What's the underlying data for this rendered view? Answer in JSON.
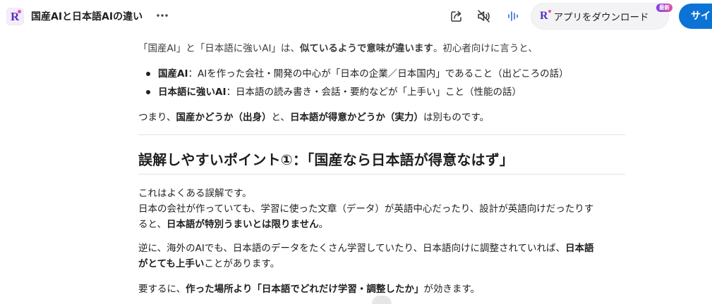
{
  "header": {
    "chat_title": "国産AIと日本語AIの違い",
    "more_icon": "more-horizontal-icon",
    "share_icon": "share-icon",
    "mute_icon": "speaker-muted-icon",
    "voice_icon": "voice-wave-icon",
    "download_label": "アプリをダウンロード",
    "new_badge": "最新",
    "signin_label": "サイ",
    "accent_color": "#0b73d6",
    "brand_color": "#5b2bc9"
  },
  "article": {
    "intro": {
      "a": "「国産AI」と「日本語に強いAI」は、",
      "b": "似ているようで意味が違います",
      "c": "。初心者向けに言うと、"
    },
    "bullets": [
      {
        "term": "国産AI",
        "text": "：AIを作った会社・開発の中心が「日本の企業／日本国内」であること（出どころの話）"
      },
      {
        "term": "日本語に強いAI",
        "text": "：日本語の読み書き・会話・要約などが「上手い」こと（性能の話）"
      }
    ],
    "summary": {
      "a": "つまり、",
      "b": "国産かどうか（出身）",
      "c": "と、",
      "d": "日本語が得意かどうか（実力）",
      "e": "は別ものです。"
    },
    "heading": "誤解しやすいポイント①：「国産なら日本語が得意なはず」",
    "block1": {
      "line1": "これはよくある誤解です。",
      "line2": "日本の会社が作っていても、学習に使った文章（データ）が英語中心だったり、設計が英語向けだったりす",
      "line3a": "ると、",
      "line3b": "日本語が特別うまいとは限りません",
      "line3c": "。"
    },
    "block2": {
      "line1a": "逆に、海外のAIでも、日本語のデータをたくさん学習していたり、日本語向けに調整されていれば、",
      "line1b": "日本語",
      "line2a": "がとても上手い",
      "line2b": "ことがあります。"
    },
    "block3": {
      "a": "要するに、",
      "b": "作った場所より「日本語でどれだけ学習・調整したか」",
      "c": "が効きます。"
    }
  }
}
